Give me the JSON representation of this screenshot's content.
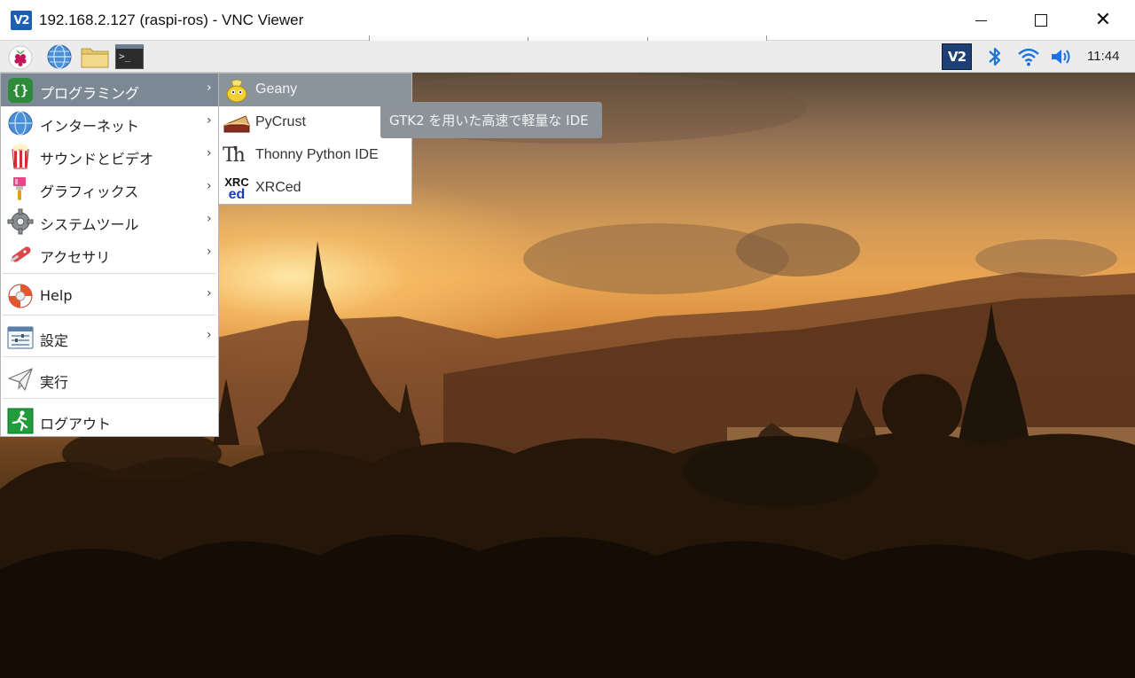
{
  "window": {
    "icon_text": "V2",
    "title": "192.168.2.127 (raspi-ros) - VNC Viewer",
    "close_glyph": "✕"
  },
  "panel": {
    "launchers": [
      "raspberry-pi-menu-icon",
      "web-browser-icon",
      "file-manager-icon",
      "terminal-icon"
    ],
    "terminal_glyph": ">_",
    "tray": {
      "vnc_text": "V2",
      "clock": "11:44"
    }
  },
  "main_menu": {
    "items": [
      {
        "label": "プログラミング",
        "icon": "programming-icon",
        "has_submenu": true,
        "active": true
      },
      {
        "label": "インターネット",
        "icon": "internet-icon",
        "has_submenu": true
      },
      {
        "label": "サウンドとビデオ",
        "icon": "sound-video-icon",
        "has_submenu": true
      },
      {
        "label": "グラフィックス",
        "icon": "graphics-icon",
        "has_submenu": true
      },
      {
        "label": "システムツール",
        "icon": "system-tools-icon",
        "has_submenu": true
      },
      {
        "label": "アクセサリ",
        "icon": "accessories-icon",
        "has_submenu": true
      },
      {
        "label": "Help",
        "icon": "help-icon",
        "has_submenu": true
      },
      {
        "label": "設定",
        "icon": "preferences-icon",
        "has_submenu": true
      },
      {
        "label": "実行",
        "icon": "run-icon",
        "has_submenu": false
      },
      {
        "label": "ログアウト",
        "icon": "logout-icon",
        "has_submenu": false
      }
    ],
    "arrow_glyph": "›",
    "programming_glyph": "{}"
  },
  "sub_menu": {
    "items": [
      {
        "label": "Geany",
        "icon": "geany-icon",
        "active": true
      },
      {
        "label": "PyCrust",
        "icon": "pycrust-icon"
      },
      {
        "label": "Thonny Python IDE",
        "icon": "thonny-icon"
      },
      {
        "label": "XRCed",
        "icon": "xrced-icon"
      }
    ],
    "thonny_glyph": "Th",
    "xrced_glyph_top": "XRC",
    "xrced_glyph_bottom": "ed"
  },
  "tooltip": {
    "text": "GTK2 を用いた高速で軽量な IDE"
  },
  "colors": {
    "menu_highlight": "#7c8894",
    "panel_bg": "#ececec",
    "tooltip_bg": "#8c9399"
  }
}
